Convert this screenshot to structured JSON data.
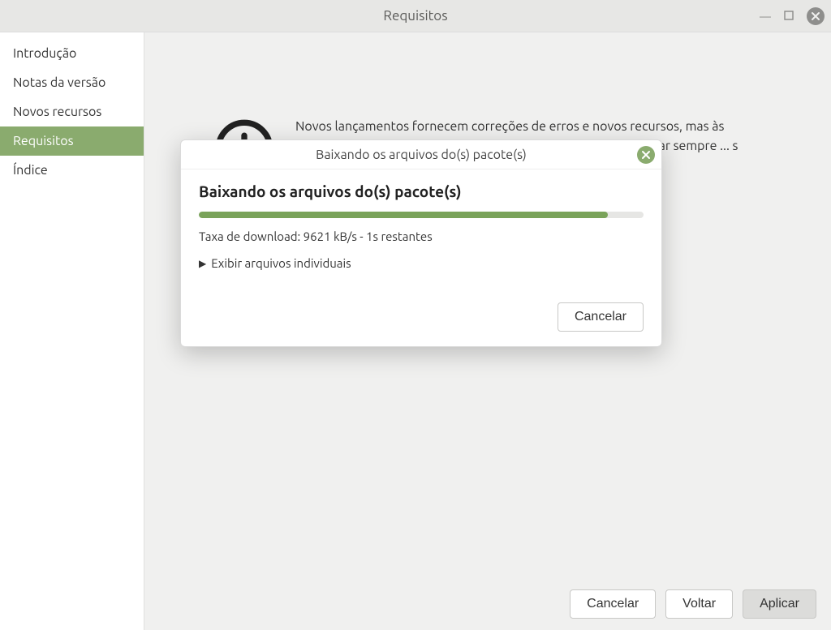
{
  "window": {
    "title": "Requisitos",
    "buttons": {
      "cancel": "Cancelar",
      "back": "Voltar",
      "apply": "Aplicar"
    }
  },
  "sidebar": {
    "items": [
      {
        "label": "Introdução",
        "active": false
      },
      {
        "label": "Notas da versão",
        "active": false
      },
      {
        "label": "Novos recursos",
        "active": false
      },
      {
        "label": "Requisitos",
        "active": true
      },
      {
        "label": "Índice",
        "active": false
      }
    ]
  },
  "content": {
    "paragraph": "Novos lançamentos fornecem correções de erros e novos recursos, mas às vezes eles também podem introduzir novos problemas. Atualizar sempre ... s problemas"
  },
  "dialog": {
    "title": "Baixando os arquivos do(s) pacote(s)",
    "heading": "Baixando os arquivos do(s) pacote(s)",
    "rate_line": "Taxa de download: 9621 kB/s - 1s restantes",
    "expander_label": "Exibir arquivos individuais",
    "cancel": "Cancelar",
    "progress_percent": 92
  }
}
